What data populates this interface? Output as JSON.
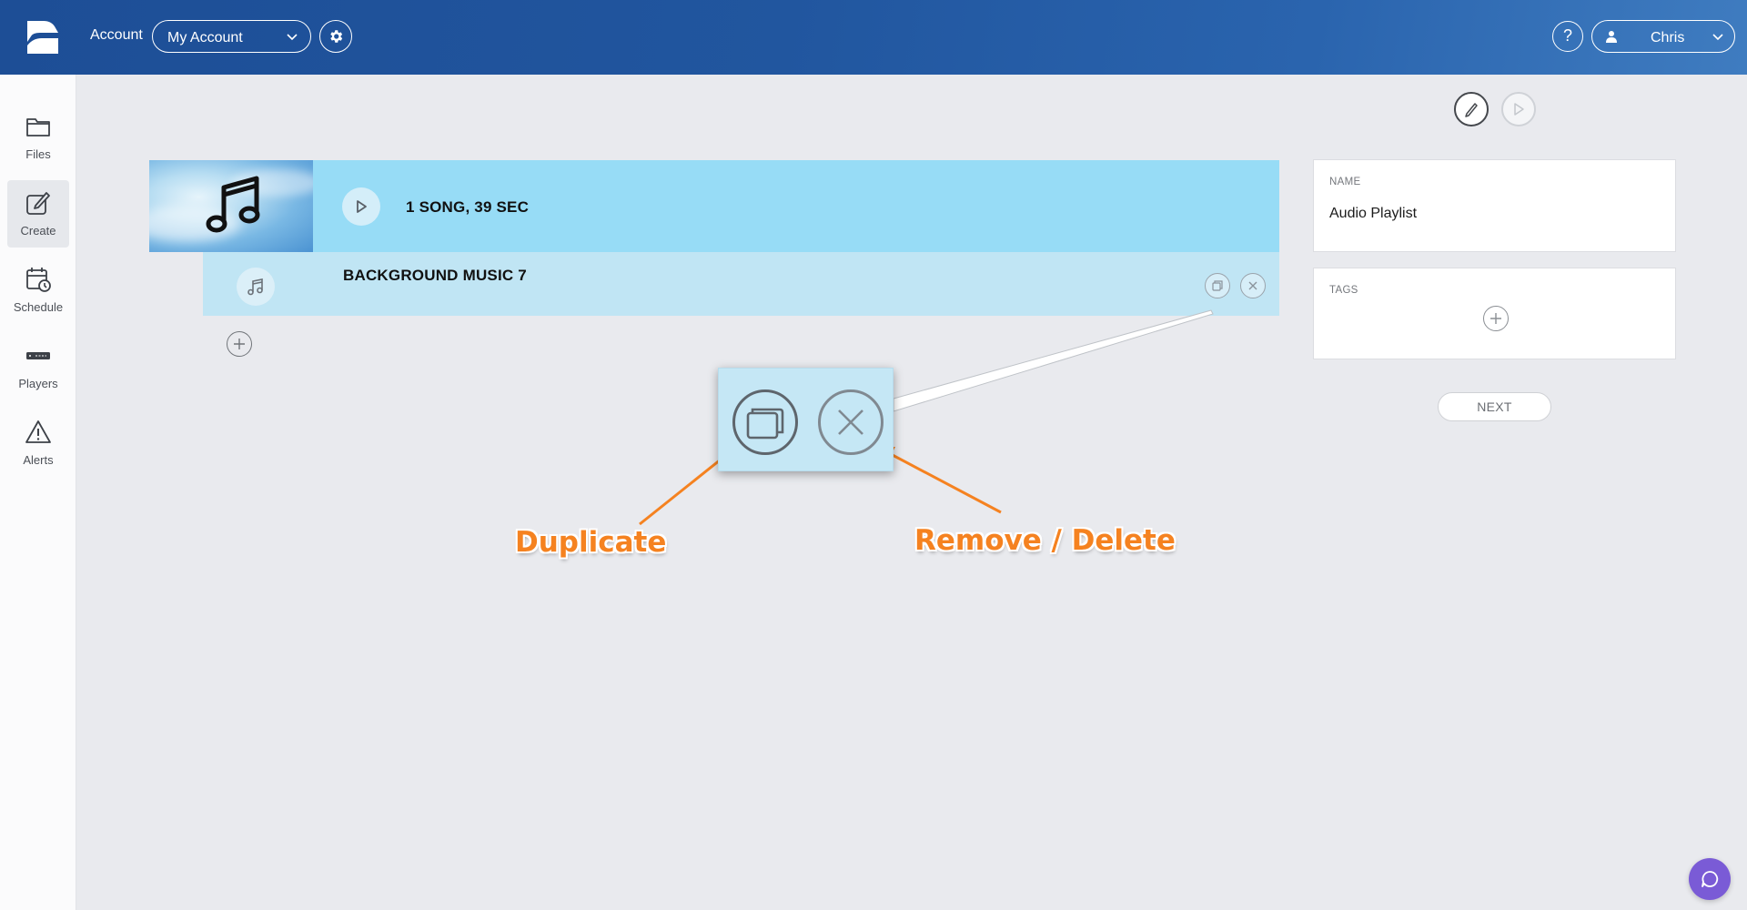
{
  "header": {
    "account_label": "Account",
    "account_selected": "My Account",
    "help_label": "?",
    "user_name": "Chris"
  },
  "sidebar": {
    "items": [
      {
        "label": "Files",
        "icon": "folder-icon"
      },
      {
        "label": "Create",
        "icon": "edit-icon",
        "active": true
      },
      {
        "label": "Schedule",
        "icon": "calendar-clock-icon"
      },
      {
        "label": "Players",
        "icon": "player-device-icon"
      },
      {
        "label": "Alerts",
        "icon": "warning-icon"
      }
    ]
  },
  "playlist": {
    "summary": "1 SONG, 39 SEC",
    "tracks": [
      {
        "title": "BACKGROUND MUSIC 7"
      }
    ]
  },
  "details": {
    "name_label": "NAME",
    "name_value": "Audio Playlist",
    "tags_label": "TAGS",
    "next_label": "NEXT"
  },
  "annotations": {
    "duplicate": "Duplicate",
    "remove": "Remove / Delete"
  },
  "colors": {
    "header_blue": "#21569f",
    "playlist_header": "#97dcf6",
    "track_row": "#c0e5f4",
    "annotation_orange": "#f58220",
    "chat_purple": "#7a5bd6"
  }
}
